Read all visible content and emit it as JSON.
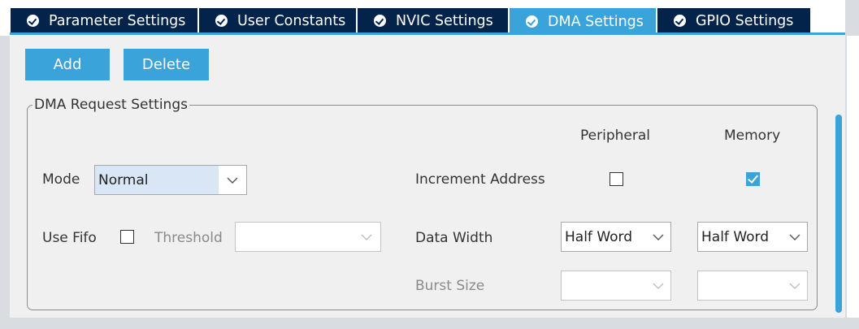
{
  "tabs": [
    {
      "label": "Parameter Settings",
      "active": false
    },
    {
      "label": "User Constants",
      "active": false
    },
    {
      "label": "NVIC Settings",
      "active": false
    },
    {
      "label": "DMA Settings",
      "active": true
    },
    {
      "label": "GPIO Settings",
      "active": false
    }
  ],
  "toolbar": {
    "add_label": "Add",
    "delete_label": "Delete"
  },
  "group": {
    "title": "DMA Request Settings",
    "mode": {
      "label": "Mode",
      "value": "Normal"
    },
    "use_fifo": {
      "label": "Use Fifo",
      "checked": false
    },
    "threshold": {
      "label": "Threshold",
      "value": ""
    },
    "columns": {
      "peripheral": "Peripheral",
      "memory": "Memory"
    },
    "increment_address": {
      "label": "Increment Address",
      "peripheral": false,
      "memory": true
    },
    "data_width": {
      "label": "Data Width",
      "peripheral": "Half Word",
      "memory": "Half Word"
    },
    "burst_size": {
      "label": "Burst Size",
      "peripheral": "",
      "memory": ""
    }
  },
  "colors": {
    "accent": "#3aa3d9",
    "tab_dark": "#03234b",
    "panel_bg": "#f0f0f0"
  },
  "icons": {
    "tab_status": "check-circle-icon",
    "dropdown": "chevron-down-icon"
  }
}
